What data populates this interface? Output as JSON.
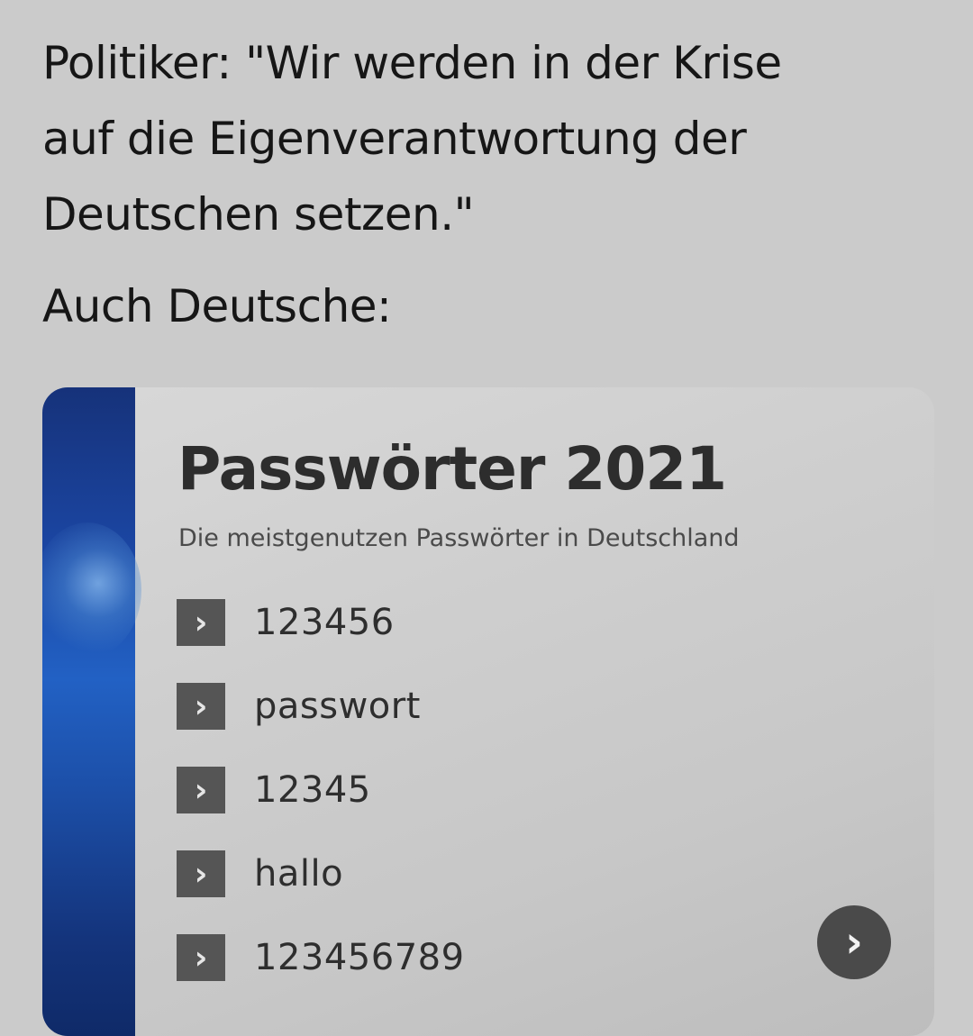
{
  "tweet": {
    "line1": "Politiker: \"Wir werden in der Krise",
    "line2": "auf die Eigenverantwortung der",
    "line3": "Deutschen setzen.\"",
    "line4": "Auch Deutsche:"
  },
  "card": {
    "title": "Passwörter 2021",
    "subtitle": "Die meistgenutzen Passwörter in Deutschland",
    "bullet_glyph": "›",
    "passwords": [
      "123456",
      "passwort",
      "12345",
      "hallo",
      "123456789"
    ],
    "next_glyph": "›",
    "accent_color": "#1b46a3"
  },
  "icons": {
    "bullet": "chevron-right-icon",
    "next": "chevron-right-circle-icon"
  }
}
